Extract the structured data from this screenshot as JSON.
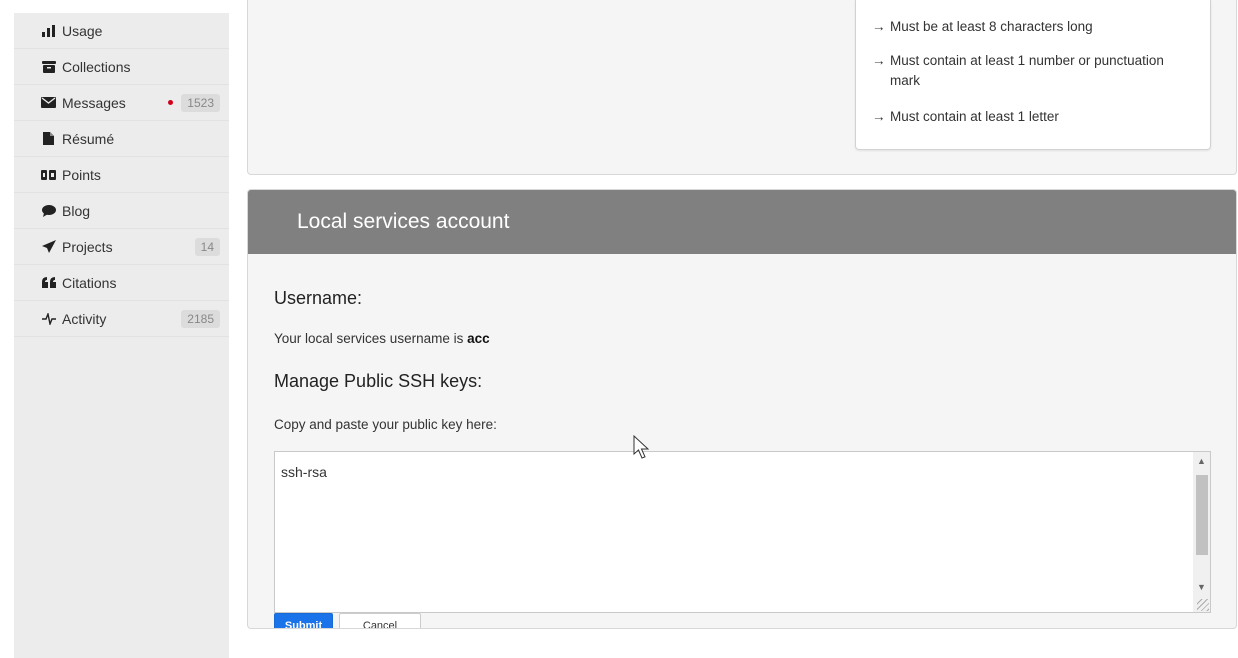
{
  "sidebar": {
    "items": [
      {
        "label": "Usage",
        "icon": "bar-chart-icon",
        "badge": null,
        "dot": false
      },
      {
        "label": "Collections",
        "icon": "archive-icon",
        "badge": null,
        "dot": false
      },
      {
        "label": "Messages",
        "icon": "envelope-icon",
        "badge": "1523",
        "dot": true
      },
      {
        "label": "Résumé",
        "icon": "document-icon",
        "badge": null,
        "dot": false
      },
      {
        "label": "Points",
        "icon": "points-icon",
        "badge": null,
        "dot": false
      },
      {
        "label": "Blog",
        "icon": "comment-icon",
        "badge": null,
        "dot": false
      },
      {
        "label": "Projects",
        "icon": "paper-plane-icon",
        "badge": "14",
        "dot": false
      },
      {
        "label": "Citations",
        "icon": "quote-icon",
        "badge": null,
        "dot": false
      },
      {
        "label": "Activity",
        "icon": "pulse-icon",
        "badge": "2185",
        "dot": false
      }
    ]
  },
  "password_rules": [
    "Must be at least 8 characters long",
    "Must contain at least 1 number or punctuation mark",
    "Must contain at least 1 letter"
  ],
  "rule_arrow": "→",
  "local_services": {
    "title": "Local services account",
    "username_heading": "Username:",
    "username_text": "Your local services username is ",
    "username_value": "acc",
    "ssh_heading": "Manage Public SSH keys:",
    "ssh_instruction": "Copy and paste your public key here:",
    "ssh_value": "ssh-rsa",
    "submit_label": "Submit",
    "cancel_label": "Cancel"
  },
  "colors": {
    "header_bg": "#808080",
    "submit_bg": "#1a73e8",
    "dot": "#d0021b"
  }
}
